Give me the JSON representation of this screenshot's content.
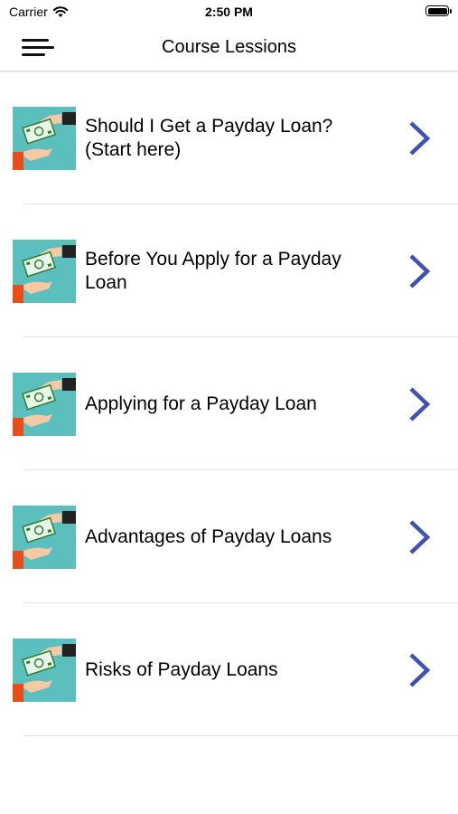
{
  "status_bar": {
    "carrier": "Carrier",
    "time": "2:50 PM"
  },
  "nav": {
    "title": "Course Lessions"
  },
  "lessons": [
    {
      "title": "Should I Get a Payday Loan? (Start here)"
    },
    {
      "title": "Before You Apply for a Payday Loan"
    },
    {
      "title": "Applying for a Payday Loan"
    },
    {
      "title": "Advantages of Payday Loans"
    },
    {
      "title": "Risks of Payday Loans"
    }
  ],
  "colors": {
    "thumb_bg": "#5bbfbe",
    "chevron": "#3f51b5",
    "divider": "#e3e3e3"
  },
  "icons": {
    "menu": "hamburger-menu-icon",
    "chevron": "chevron-right-icon",
    "thumb": "money-hand-icon"
  }
}
